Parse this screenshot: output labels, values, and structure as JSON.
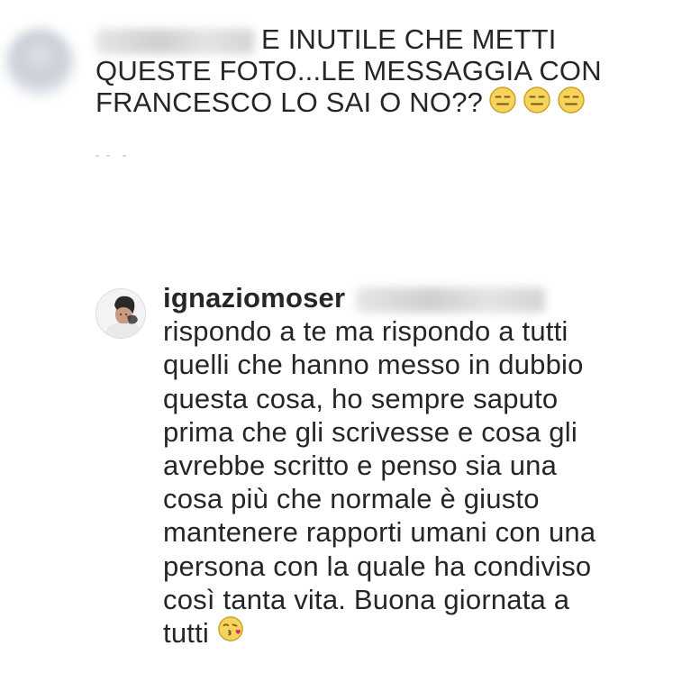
{
  "comment_1": {
    "username": "",
    "lines": [
      "E INUTILE CHE METTI",
      "QUESTE FOTO...LE MESSAGGIA CON",
      "FRANCESCO LO SAI O NO??"
    ],
    "emojis": [
      "expressionless-face",
      "expressionless-face",
      "expressionless-face"
    ]
  },
  "comment_2": {
    "username": "ignaziomoser",
    "lines": [
      "rispondo a te ma rispondo a tutti",
      "quelli che hanno messo in dubbio",
      "questa cosa, ho sempre saputo",
      "prima che gli scrivesse e cosa gli",
      "avrebbe scritto e penso sia una",
      "cosa più che normale è giusto",
      "mantenere rapporti umani con una",
      "persona con la quale ha condiviso",
      "così tanta vita. Buona giornata a",
      "tutti"
    ],
    "trailing_emoji": "face-blowing-a-kiss"
  },
  "colors": {
    "text": "#262626",
    "emoji_yellow": "#f6d35a",
    "emoji_outline": "#c9a227",
    "kiss_heart": "#e0245e"
  }
}
